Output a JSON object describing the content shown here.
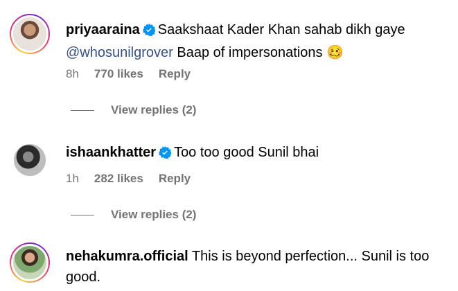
{
  "comments": [
    {
      "username": "priyaaraina",
      "verified": true,
      "text": "Saakshaat Kader Khan sahab dikh gaye",
      "mention": "@whosunilgrover",
      "text_after": "Baap of impersonations",
      "emoji": "🥴",
      "time": "8h",
      "likes": "770 likes",
      "reply": "Reply",
      "view_replies": "View replies (2)"
    },
    {
      "username": "ishaankhatter",
      "verified": true,
      "text": "Too too good Sunil bhai",
      "time": "1h",
      "likes": "282 likes",
      "reply": "Reply",
      "view_replies": "View replies (2)"
    },
    {
      "username": "nehakumra.official",
      "verified": false,
      "text": "This is beyond perfection... Sunil is too good."
    }
  ],
  "colors": {
    "verified": "#0095f6",
    "meta": "#737373",
    "mention": "#385185"
  }
}
